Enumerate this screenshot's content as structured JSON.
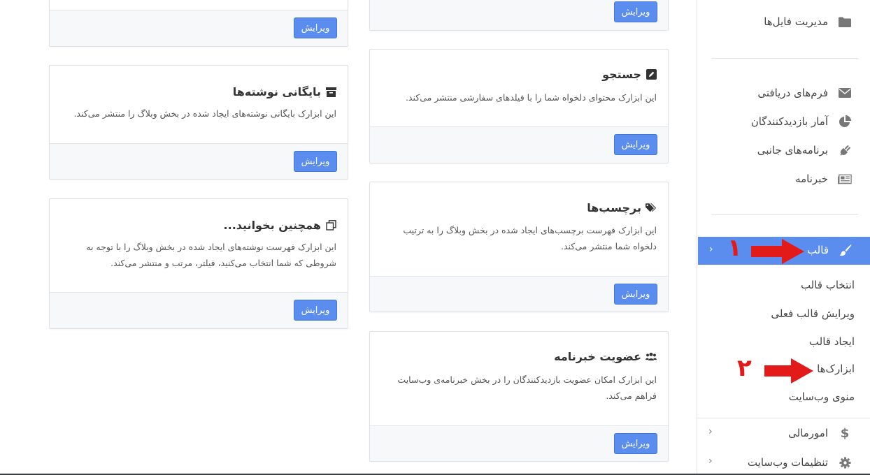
{
  "cards": {
    "top_left_edit": "ویرایش",
    "top_right_edit": "ویرایش",
    "archive": {
      "title": "بایگانی نوشته‌ها",
      "desc": "این ابزارک بایگانی نوشته‌های ایجاد شده در بخش وبلاگ را منتشر می‌کند.",
      "edit": "ویرایش",
      "icon": "archive-icon"
    },
    "search": {
      "title": "جستجو",
      "desc": "این ابزارک محتوای دلخواه شما را با فیلدهای سفارشی منتشر می‌کند.",
      "edit": "ویرایش",
      "icon": "edit-icon"
    },
    "related": {
      "title": "همچنین بخوانید...",
      "desc": "این ابزارک فهرست نوشته‌های ایجاد شده در بخش وبلاگ را با توجه به شروطی که شما انتخاب می‌کنید، فیلتر، مرتب و منتشر می‌کند.",
      "edit": "ویرایش",
      "icon": "copy-icon"
    },
    "tags": {
      "title": "برچسب‌ها",
      "desc": "این ابزارک فهرست برچسب‌های ایجاد شده در بخش وبلاگ را به ترتیب دلخواه شما منتشر می‌کند.",
      "edit": "ویرایش",
      "icon": "tags-icon"
    },
    "newsletter": {
      "title": "عضویت خبرنامه",
      "desc": "این ابزارک امکان عضویت بازدیدکنندگان را در بخش خبرنامه‌ی وب‌سایت فراهم می‌کند.",
      "edit": "ویرایش",
      "icon": "users-icon"
    }
  },
  "sidebar": {
    "file_manager": "مدیریت فایل‌ها",
    "forms": "فرم‌های دریافتی",
    "stats": "آمار بازدیدکنندگان",
    "plugins": "برنامه‌های جانبی",
    "newsletter": "خبرنامه",
    "theme": "قالب",
    "theme_sub": [
      "انتخاب قالب",
      "ویرایش قالب فعلی",
      "ایجاد قالب",
      "ابزارک‌ها",
      "منوی وب‌سایت"
    ],
    "finance": "امورمالی",
    "settings": "تنظیمات وب‌سایت"
  },
  "annotations": {
    "one": "۱",
    "two": "۲"
  },
  "colors": {
    "accent": "#5b8def",
    "annotation": "#e21a1a"
  }
}
